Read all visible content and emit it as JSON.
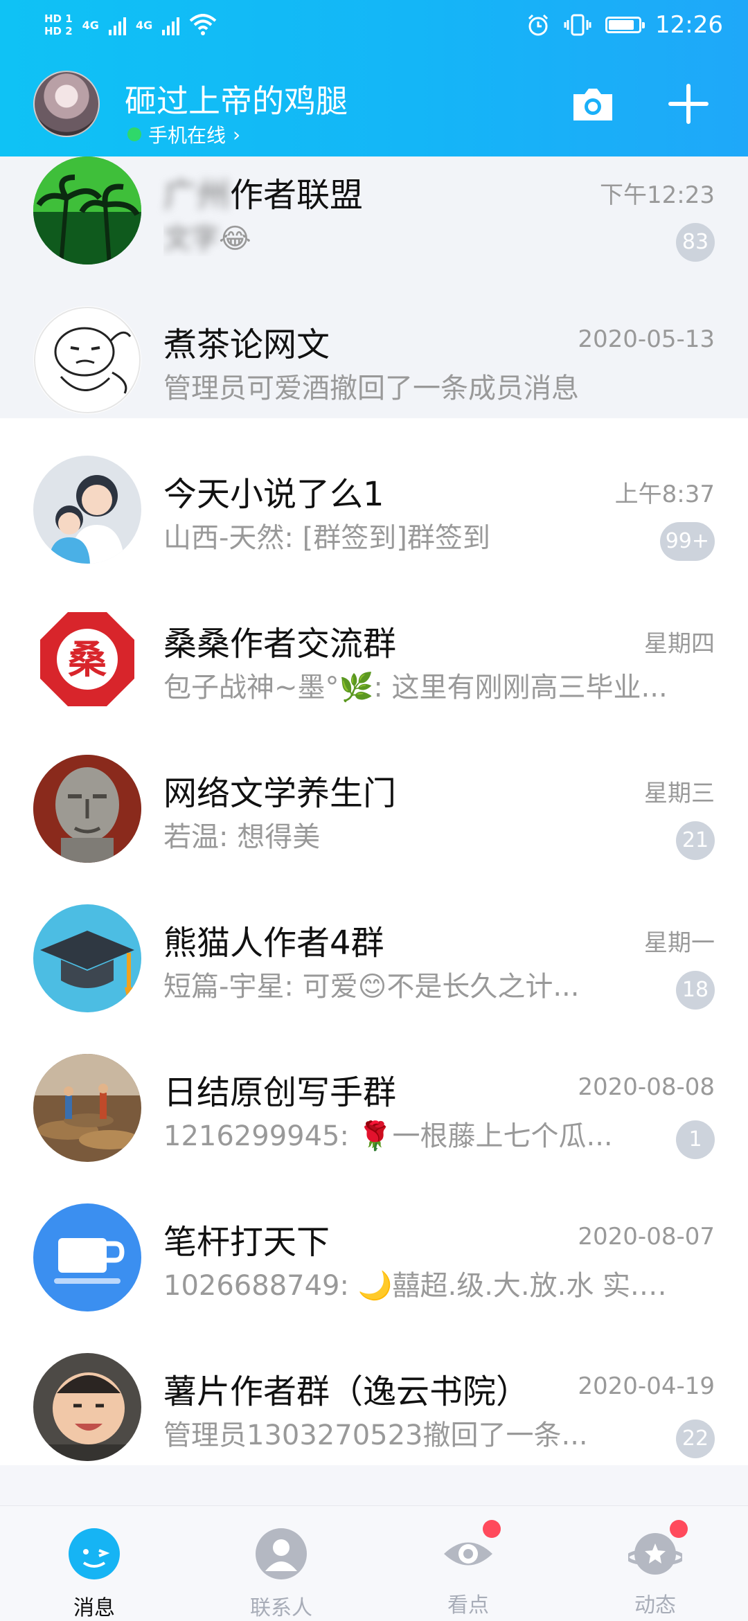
{
  "status_bar": {
    "hd1": "HD 1",
    "hd2": "HD 2",
    "net1": "4G",
    "net2": "4G",
    "time": "12:26",
    "icons": [
      "alarm-icon",
      "vibrate-icon",
      "battery-icon",
      "wifi-icon"
    ],
    "battery_level": 0.9
  },
  "header": {
    "profile_name": "砸过上帝的鸡腿",
    "online_status": "手机在线",
    "chevron": "›",
    "buttons": [
      "camera-icon",
      "plus-icon"
    ],
    "colors": {
      "gradient_start": "#0fc2f5",
      "gradient_end": "#1fa8f9",
      "online_dot": "#2fd86a"
    }
  },
  "chats": [
    {
      "title": "广 作者联盟",
      "title_visible": "作者联盟",
      "time": "下午12:23",
      "preview": "😂",
      "badge": "83",
      "pinned": true,
      "avatar": "palm-trees-avatar"
    },
    {
      "title": "煮茶论网文",
      "time": "2020-05-13",
      "preview": "管理员可爱酒撤回了一条成员消息",
      "badge": "",
      "pinned": true,
      "avatar": "cartoon-face-avatar"
    },
    {
      "title": "今天小说了么1",
      "time": "上午8:37",
      "preview": "山西-天然: [群签到]群签到",
      "badge": "99+",
      "pinned": false,
      "avatar": "family-avatar"
    },
    {
      "title": "桑桑作者交流群",
      "time": "星期四",
      "preview": "包子战神~墨°🌿: 这里有刚刚高三毕业...",
      "badge": "",
      "pinned": false,
      "avatar": "sang-logo-avatar"
    },
    {
      "title": "网络文学养生门",
      "time": "星期三",
      "preview": "若温: 想得美",
      "badge": "21",
      "pinned": false,
      "avatar": "stone-statue-avatar"
    },
    {
      "title": "熊猫人作者4群",
      "time": "星期一",
      "preview": "短篇-宇星: 可爱😊不是长久之计...",
      "badge": "18",
      "pinned": false,
      "avatar": "graduation-cap-avatar"
    },
    {
      "title": "日结原创写手群",
      "time": "2020-08-08",
      "preview": "1216299945: 🌹一根藤上七个瓜...",
      "badge": "1",
      "pinned": false,
      "avatar": "coins-avatar"
    },
    {
      "title": "笔杆打天下",
      "time": "2020-08-07",
      "preview": "1026688749: 🌙囍超.级.大.放.水  实.测...",
      "badge": "",
      "pinned": false,
      "avatar": "cup-avatar"
    },
    {
      "title": "薯片作者群（逸云书院）",
      "time": "2020-04-19",
      "preview": "管理员1303270523撤回了一条...",
      "badge": "22",
      "pinned": false,
      "avatar": "baby-photo-avatar"
    }
  ],
  "tabs": [
    {
      "label": "消息",
      "active": true,
      "icon": "chat-bubble-icon",
      "dot": false
    },
    {
      "label": "联系人",
      "active": false,
      "icon": "contacts-icon",
      "dot": false
    },
    {
      "label": "看点",
      "active": false,
      "icon": "eye-icon",
      "dot": true
    },
    {
      "label": "动态",
      "active": false,
      "icon": "star-planet-icon",
      "dot": true
    }
  ]
}
